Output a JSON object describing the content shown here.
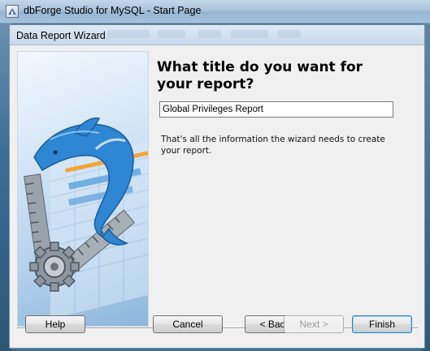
{
  "app": {
    "window_title": "dbForge Studio for MySQL - Start Page"
  },
  "dialog": {
    "title": "Data Report Wizard",
    "heading": "What title do you want for your report?",
    "title_input_value": "Global Privileges Report",
    "info_text": "That's all the information the wizard needs to create your report."
  },
  "buttons": {
    "help": "Help",
    "cancel": "Cancel",
    "back": "< Back",
    "next": "Next >",
    "finish": "Finish"
  },
  "icons": [
    "app-icon",
    "dolphin-logo",
    "ruler-gear-illustration"
  ],
  "colors": {
    "title_bar": "#a9c3dd",
    "dialog_bg": "#f0f0f0",
    "art_blue": "#3a8fd6",
    "accent_orange": "#f5a33a"
  }
}
